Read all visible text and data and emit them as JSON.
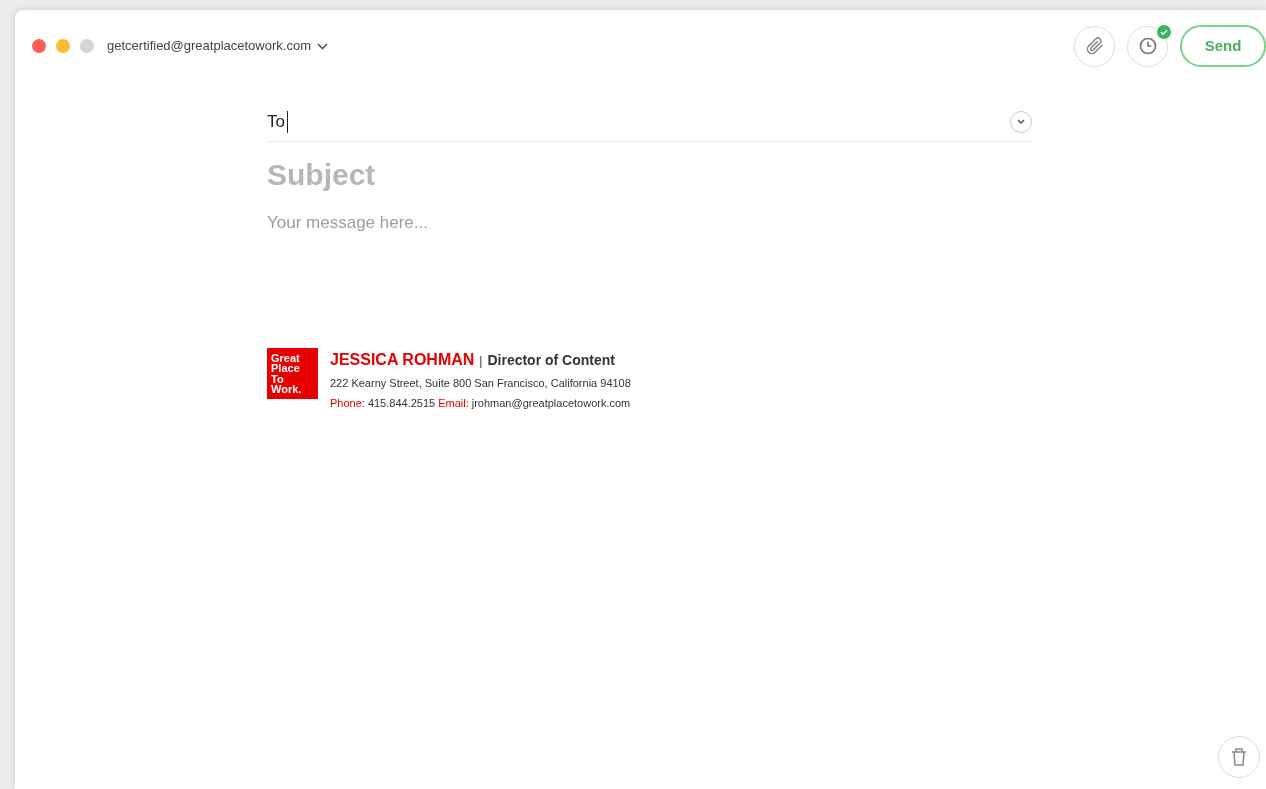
{
  "window": {
    "account": "getcertified@greatplacetowork.com"
  },
  "toolbar": {
    "schedule_set": true,
    "send_label": "Send"
  },
  "compose": {
    "to_label": "To",
    "subject_placeholder": "Subject",
    "message_placeholder": "Your message here..."
  },
  "signature": {
    "logo_lines": [
      "Great",
      "Place",
      "To",
      "Work."
    ],
    "name": "JESSICA ROHMAN",
    "separator": "|",
    "title": "Director of Content",
    "address": "222 Kearny Street, Suite 800 San Francisco, California 94108",
    "phone_label": "Phone:",
    "phone": "415.844.2515",
    "email_label": "Email:",
    "email": "jrohman@greatplacetowork.com"
  }
}
